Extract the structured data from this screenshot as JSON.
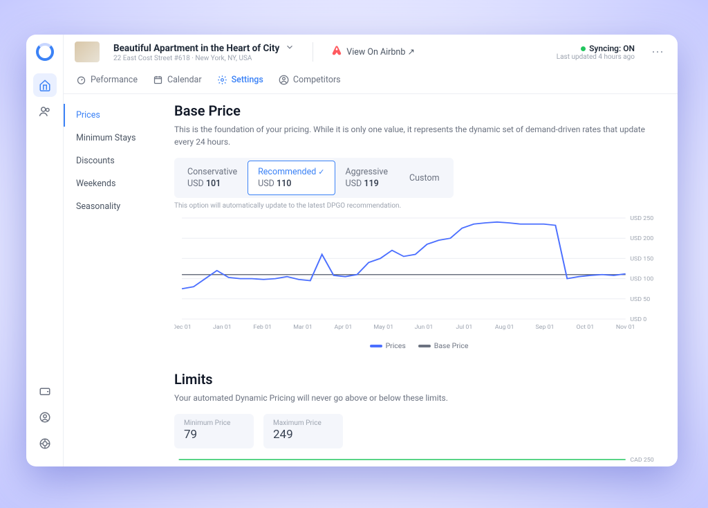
{
  "listing": {
    "title": "Beautiful Apartment in the Heart of City",
    "subtitle": "22 East Cost Street #618 · New York, NY, USA"
  },
  "airbnb_link_label": "View On Airbnb ↗",
  "sync": {
    "status": "Syncing: ON",
    "updated": "Last updated 4 hours ago"
  },
  "tabs": [
    {
      "label": "Peformance"
    },
    {
      "label": "Calendar"
    },
    {
      "label": "Settings"
    },
    {
      "label": "Competitors"
    }
  ],
  "sidenav": {
    "items": [
      "Prices",
      "Minimum Stays",
      "Discounts",
      "Weekends",
      "Seasonality"
    ]
  },
  "base_price": {
    "title": "Base Price",
    "desc": "This is the foundation of your pricing. While it is only one value, it represents the dynamic set of demand-driven rates that update every 24 hours.",
    "options": [
      {
        "label": "Conservative",
        "currency": "USD",
        "amount": "101"
      },
      {
        "label": "Recommended",
        "currency": "USD",
        "amount": "110"
      },
      {
        "label": "Aggressive",
        "currency": "USD",
        "amount": "119"
      }
    ],
    "custom_label": "Custom",
    "note": "This option will automatically update to the latest DPGO recommendation."
  },
  "legend": {
    "prices": "Prices",
    "base": "Base Price"
  },
  "limits": {
    "title": "Limits",
    "desc": "Your automated Dynamic Pricing will never go above or below these limits.",
    "min_label": "Minimum Price",
    "min_value": "79",
    "max_label": "Maximum Price",
    "max_value": "249"
  },
  "chart_data": {
    "type": "line",
    "title": "Base Price",
    "xlabel": "",
    "ylabel": "USD",
    "ylim": [
      0,
      250
    ],
    "base_price": 110,
    "y_ticks": [
      "USD 250",
      "USD 200",
      "USD 150",
      "USD 100",
      "USD 50",
      "USD 0"
    ],
    "categories": [
      "Dec 01",
      "Jan 01",
      "Feb 01",
      "Mar 01",
      "Apr 01",
      "May 01",
      "Jun 01",
      "Jul 01",
      "Aug 01",
      "Sep 01",
      "Oct 01",
      "Nov 01"
    ],
    "series": [
      {
        "name": "Prices",
        "values": [
          75,
          80,
          100,
          120,
          103,
          100,
          100,
          98,
          100,
          105,
          98,
          95,
          160,
          108,
          105,
          110,
          140,
          150,
          170,
          155,
          160,
          185,
          195,
          200,
          225,
          235,
          238,
          240,
          238,
          235,
          235,
          235,
          232,
          100,
          105,
          108,
          110,
          108,
          112
        ]
      },
      {
        "name": "Base Price",
        "constant": 110
      }
    ],
    "second_chart_y_tick": "CAD 250"
  }
}
